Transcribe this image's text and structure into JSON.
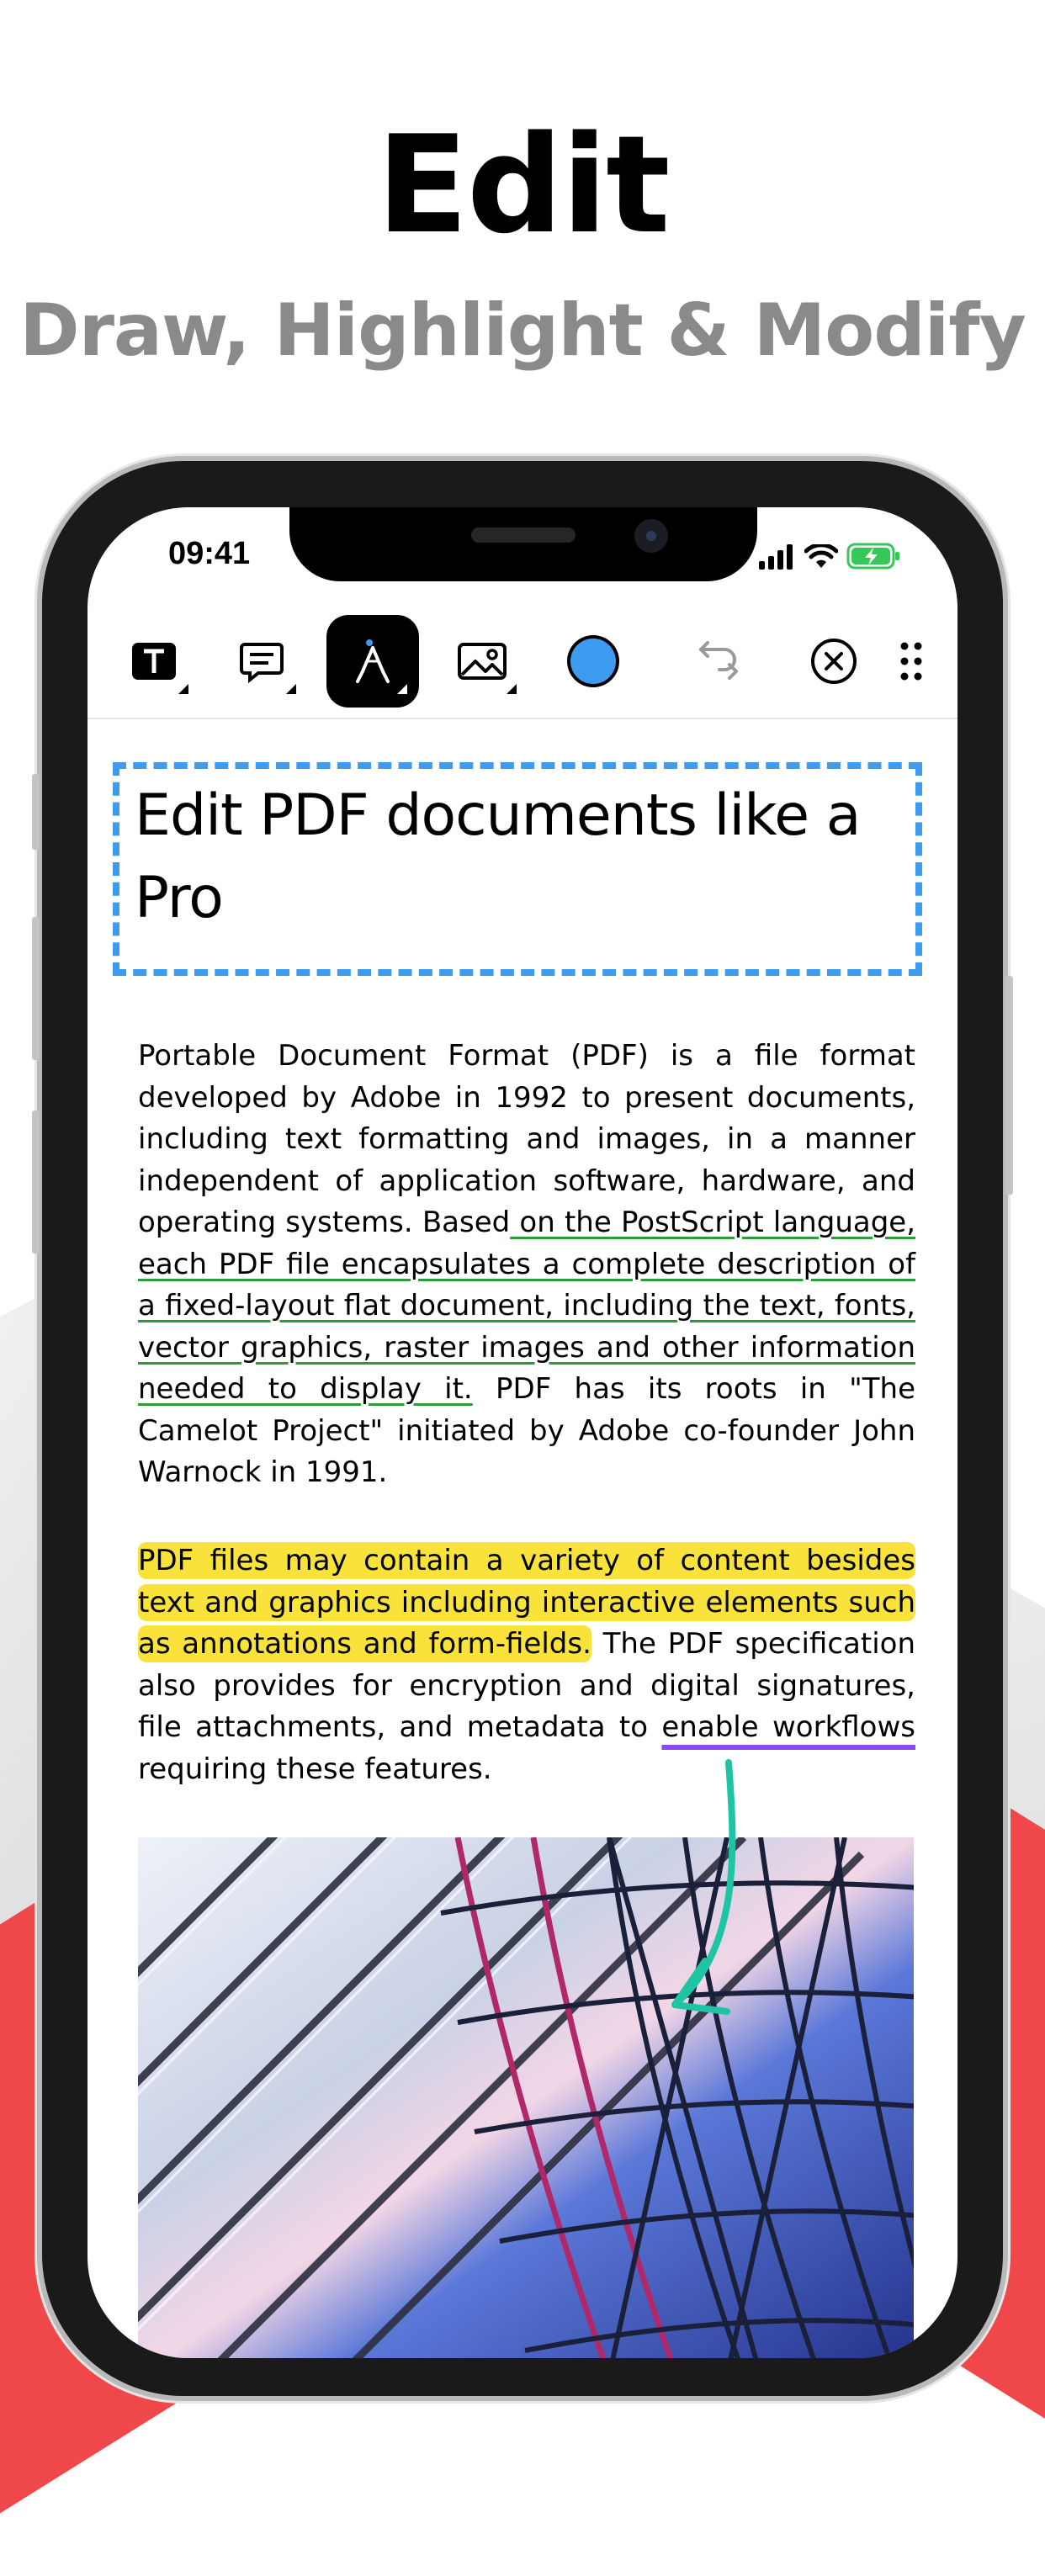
{
  "hero": {
    "title": "Edit",
    "subtitle": "Draw, Highlight & Modify"
  },
  "status_bar": {
    "time": "09:41"
  },
  "toolbar": {
    "tools": [
      {
        "name": "text-tool",
        "icon": "text-box-icon",
        "has_menu": true
      },
      {
        "name": "comment-tool",
        "icon": "comment-icon",
        "has_menu": true
      },
      {
        "name": "draw-tool",
        "icon": "pen-nib-icon",
        "has_menu": true,
        "active": true
      },
      {
        "name": "image-tool",
        "icon": "image-icon",
        "has_menu": true
      },
      {
        "name": "color-picker",
        "icon": "color-dot-icon",
        "color": "#3d9cf0"
      },
      {
        "name": "undo",
        "icon": "undo-icon",
        "disabled": true
      },
      {
        "name": "close",
        "icon": "close-circle-icon"
      },
      {
        "name": "more",
        "icon": "grip-icon"
      }
    ]
  },
  "document": {
    "title": "Edit PDF documents like a Pro",
    "para1_a": "Portable Document Format (PDF) is a file format developed by Adobe in 1992 to present documents, including text formatting and images, in a manner independent of application software, hardware, and operating systems. Based",
    "para1_underlined": " on the PostScript language, each PDF file encapsulates a complete description of a fixed-layout flat document, including the text, fonts, vector graphics, raster images and other information needed to display it.",
    "para1_b": " PDF has its roots in \"The Camelot Project\" initiated by Adobe co-founder John Warnock in 1991.",
    "para2_highlighted": "PDF files may contain a variety of content besides text and graphics including interactive elements such as annotations and form-fields.",
    "para2_a": " The PDF specification also provides for encryption and digital signatures, file attachments, and metadata to ",
    "para2_underlined": "enable workflows",
    "para2_b": " requiring these features."
  },
  "colors": {
    "accent_blue": "#3d9cf0",
    "highlight_yellow": "#f9e33a",
    "underline_green": "#2e9a3a",
    "underline_purple": "#8a4af0",
    "arrow_teal": "#1fc4a4",
    "brand_red": "#f0474b"
  }
}
